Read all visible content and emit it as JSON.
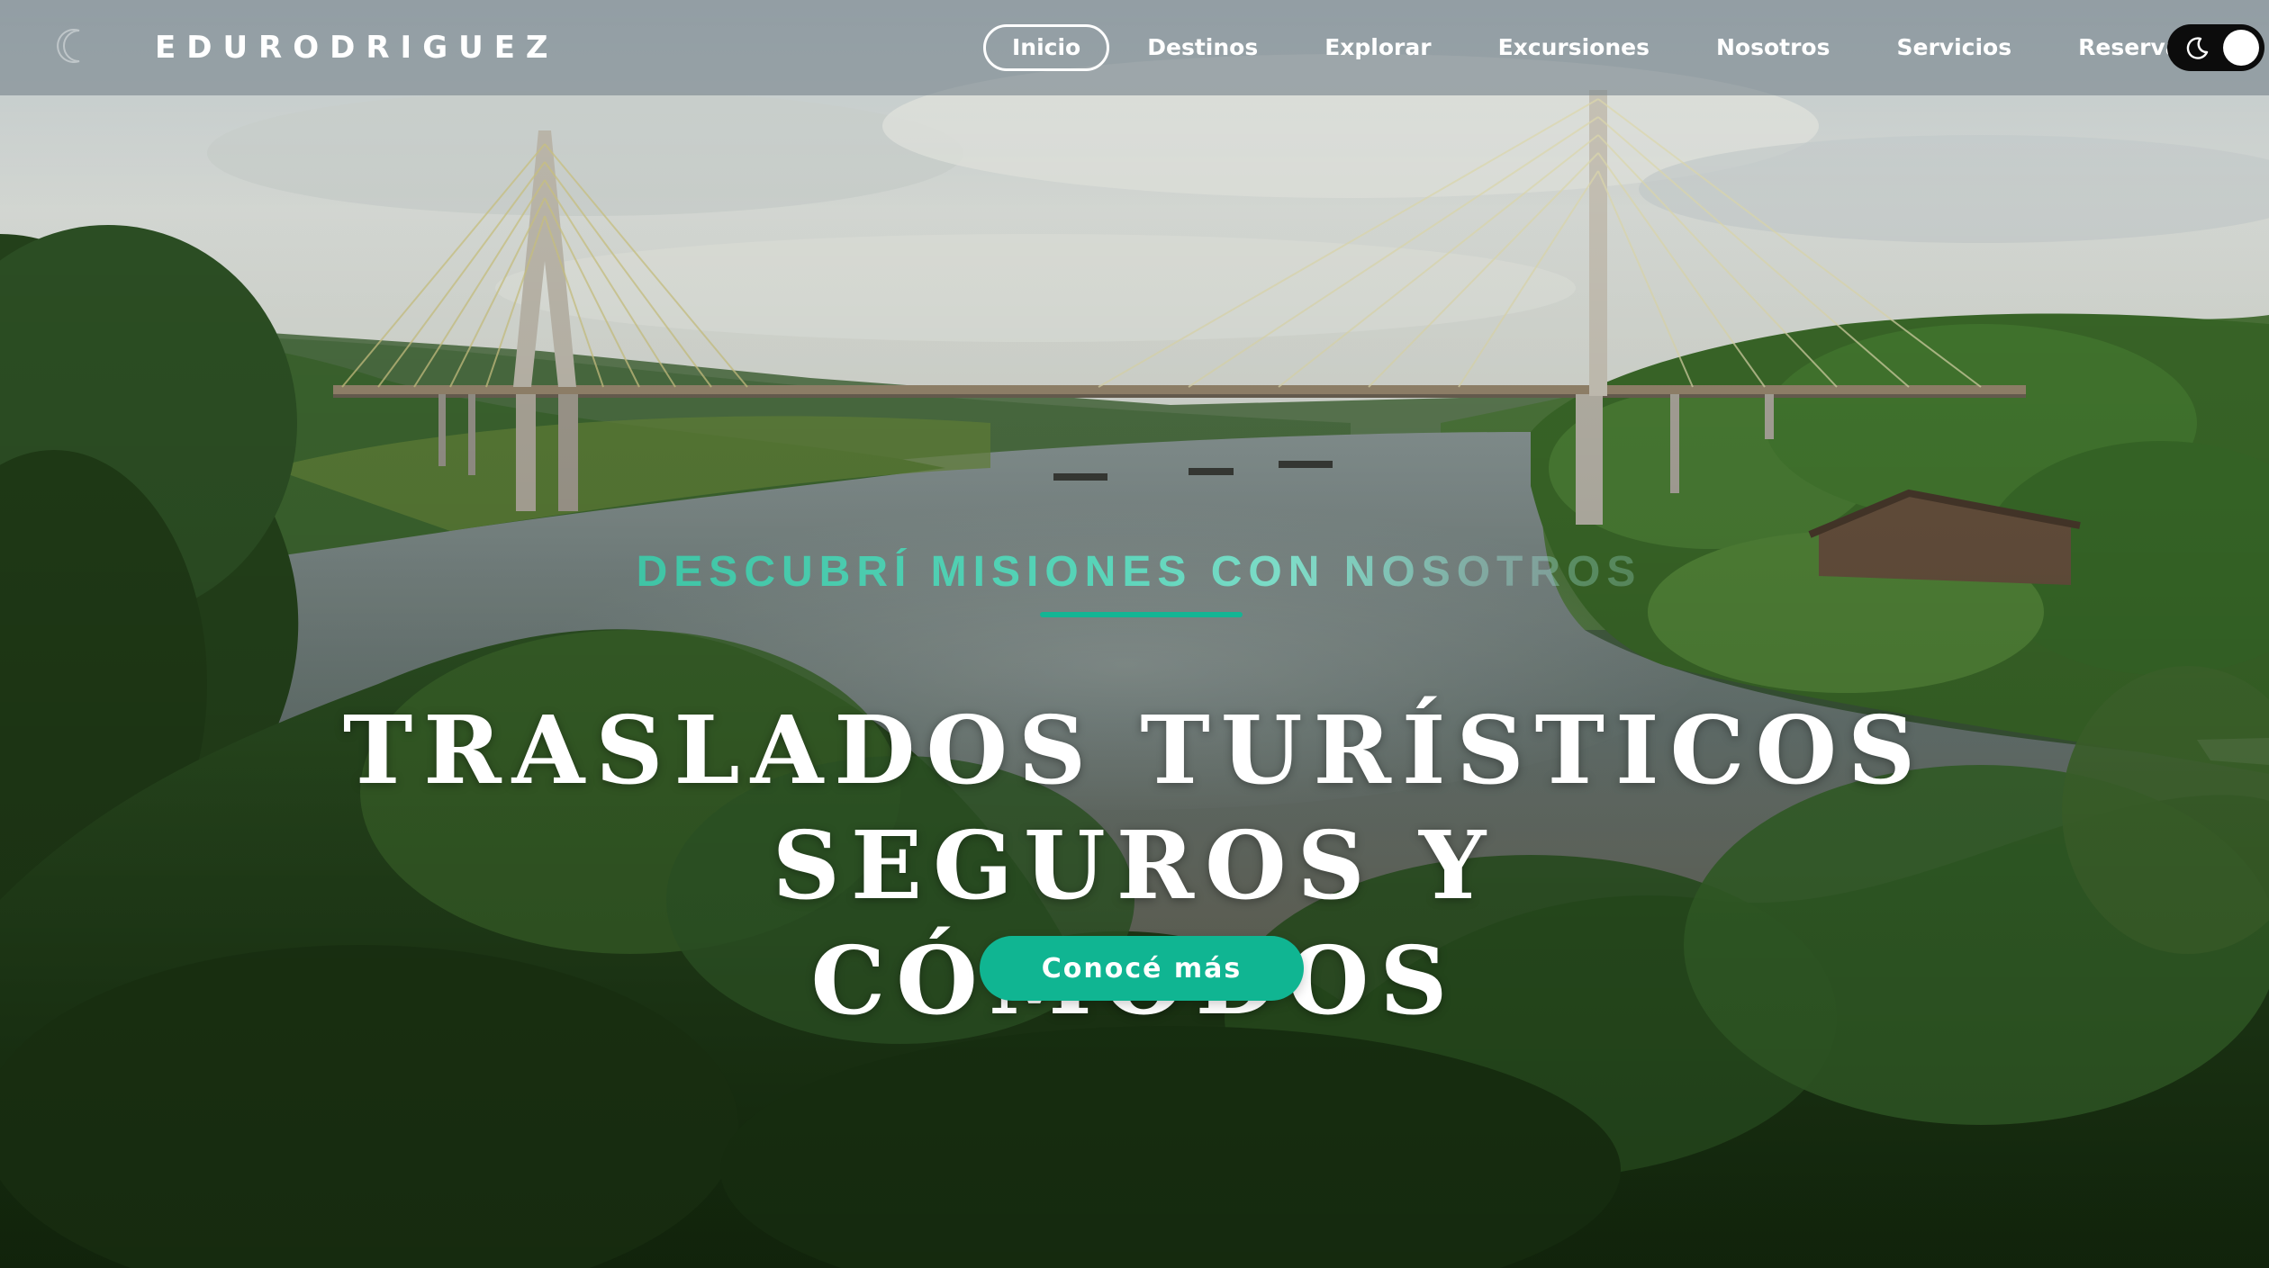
{
  "brand": {
    "name": "EDURODRIGUEZ",
    "mark_icon": "crescent-logo-icon"
  },
  "nav": {
    "items": [
      {
        "label": "Inicio",
        "active": true
      },
      {
        "label": "Destinos",
        "active": false
      },
      {
        "label": "Explorar",
        "active": false
      },
      {
        "label": "Excursiones",
        "active": false
      },
      {
        "label": "Nosotros",
        "active": false
      },
      {
        "label": "Servicios",
        "active": false
      },
      {
        "label": "Reservar",
        "active": false
      }
    ],
    "theme_toggle": {
      "icon": "moon-icon",
      "state": "dark-mode-off"
    }
  },
  "hero": {
    "tagline": "DESCUBRÍ MISIONES CON NOSOTROS",
    "title_line1": "TRASLADOS TURÍSTICOS SEGUROS Y",
    "title_line2": "CÓMODOS",
    "cta_label": "Conocé más",
    "background_image": "river with cable-stayed bridge and jungle"
  },
  "colors": {
    "accent": "#10b592",
    "tagline": "#4fd1b3",
    "navbar_bg": "#78848c",
    "toggle_bg": "#0c0c0c",
    "text_light": "#ffffff"
  }
}
